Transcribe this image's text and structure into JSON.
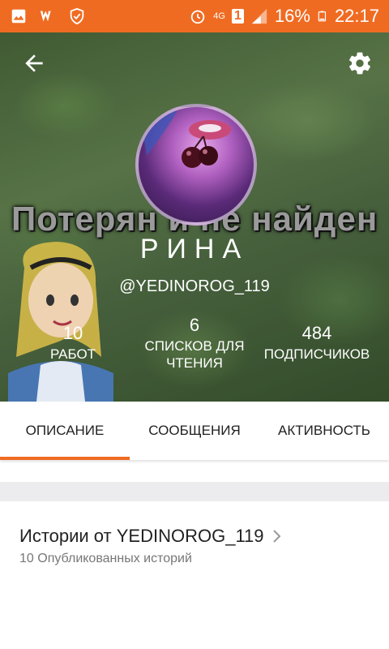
{
  "status_bar": {
    "battery_percent": "16%",
    "time": "22:17",
    "network": "4G",
    "sim_badge": "1",
    "colors": {
      "bg": "#f06b22"
    },
    "icons": [
      "gallery-icon",
      "wattpad-icon",
      "shield-check-icon",
      "alarm-icon",
      "signal-icon",
      "battery-icon"
    ]
  },
  "header": {
    "banner_text": "Потерян и не найден",
    "name": "РИНА",
    "handle": "@YEDINOROG_119",
    "stats": [
      {
        "value": "10",
        "label": "РАБОТ"
      },
      {
        "value": "6",
        "label": "СПИСКОВ ДЛЯ ЧТЕНИЯ"
      },
      {
        "value": "484",
        "label": "ПОДПИСЧИКОВ"
      }
    ]
  },
  "tabs": [
    {
      "label": "ОПИСАНИЕ",
      "active": true
    },
    {
      "label": "СООБЩЕНИЯ",
      "active": false
    },
    {
      "label": "АКТИВНОСТЬ",
      "active": false
    }
  ],
  "stories": {
    "title": "Истории от YEDINOROG_119",
    "subtitle": "10 Опубликованных историй"
  },
  "accent_color": "#f06b22"
}
